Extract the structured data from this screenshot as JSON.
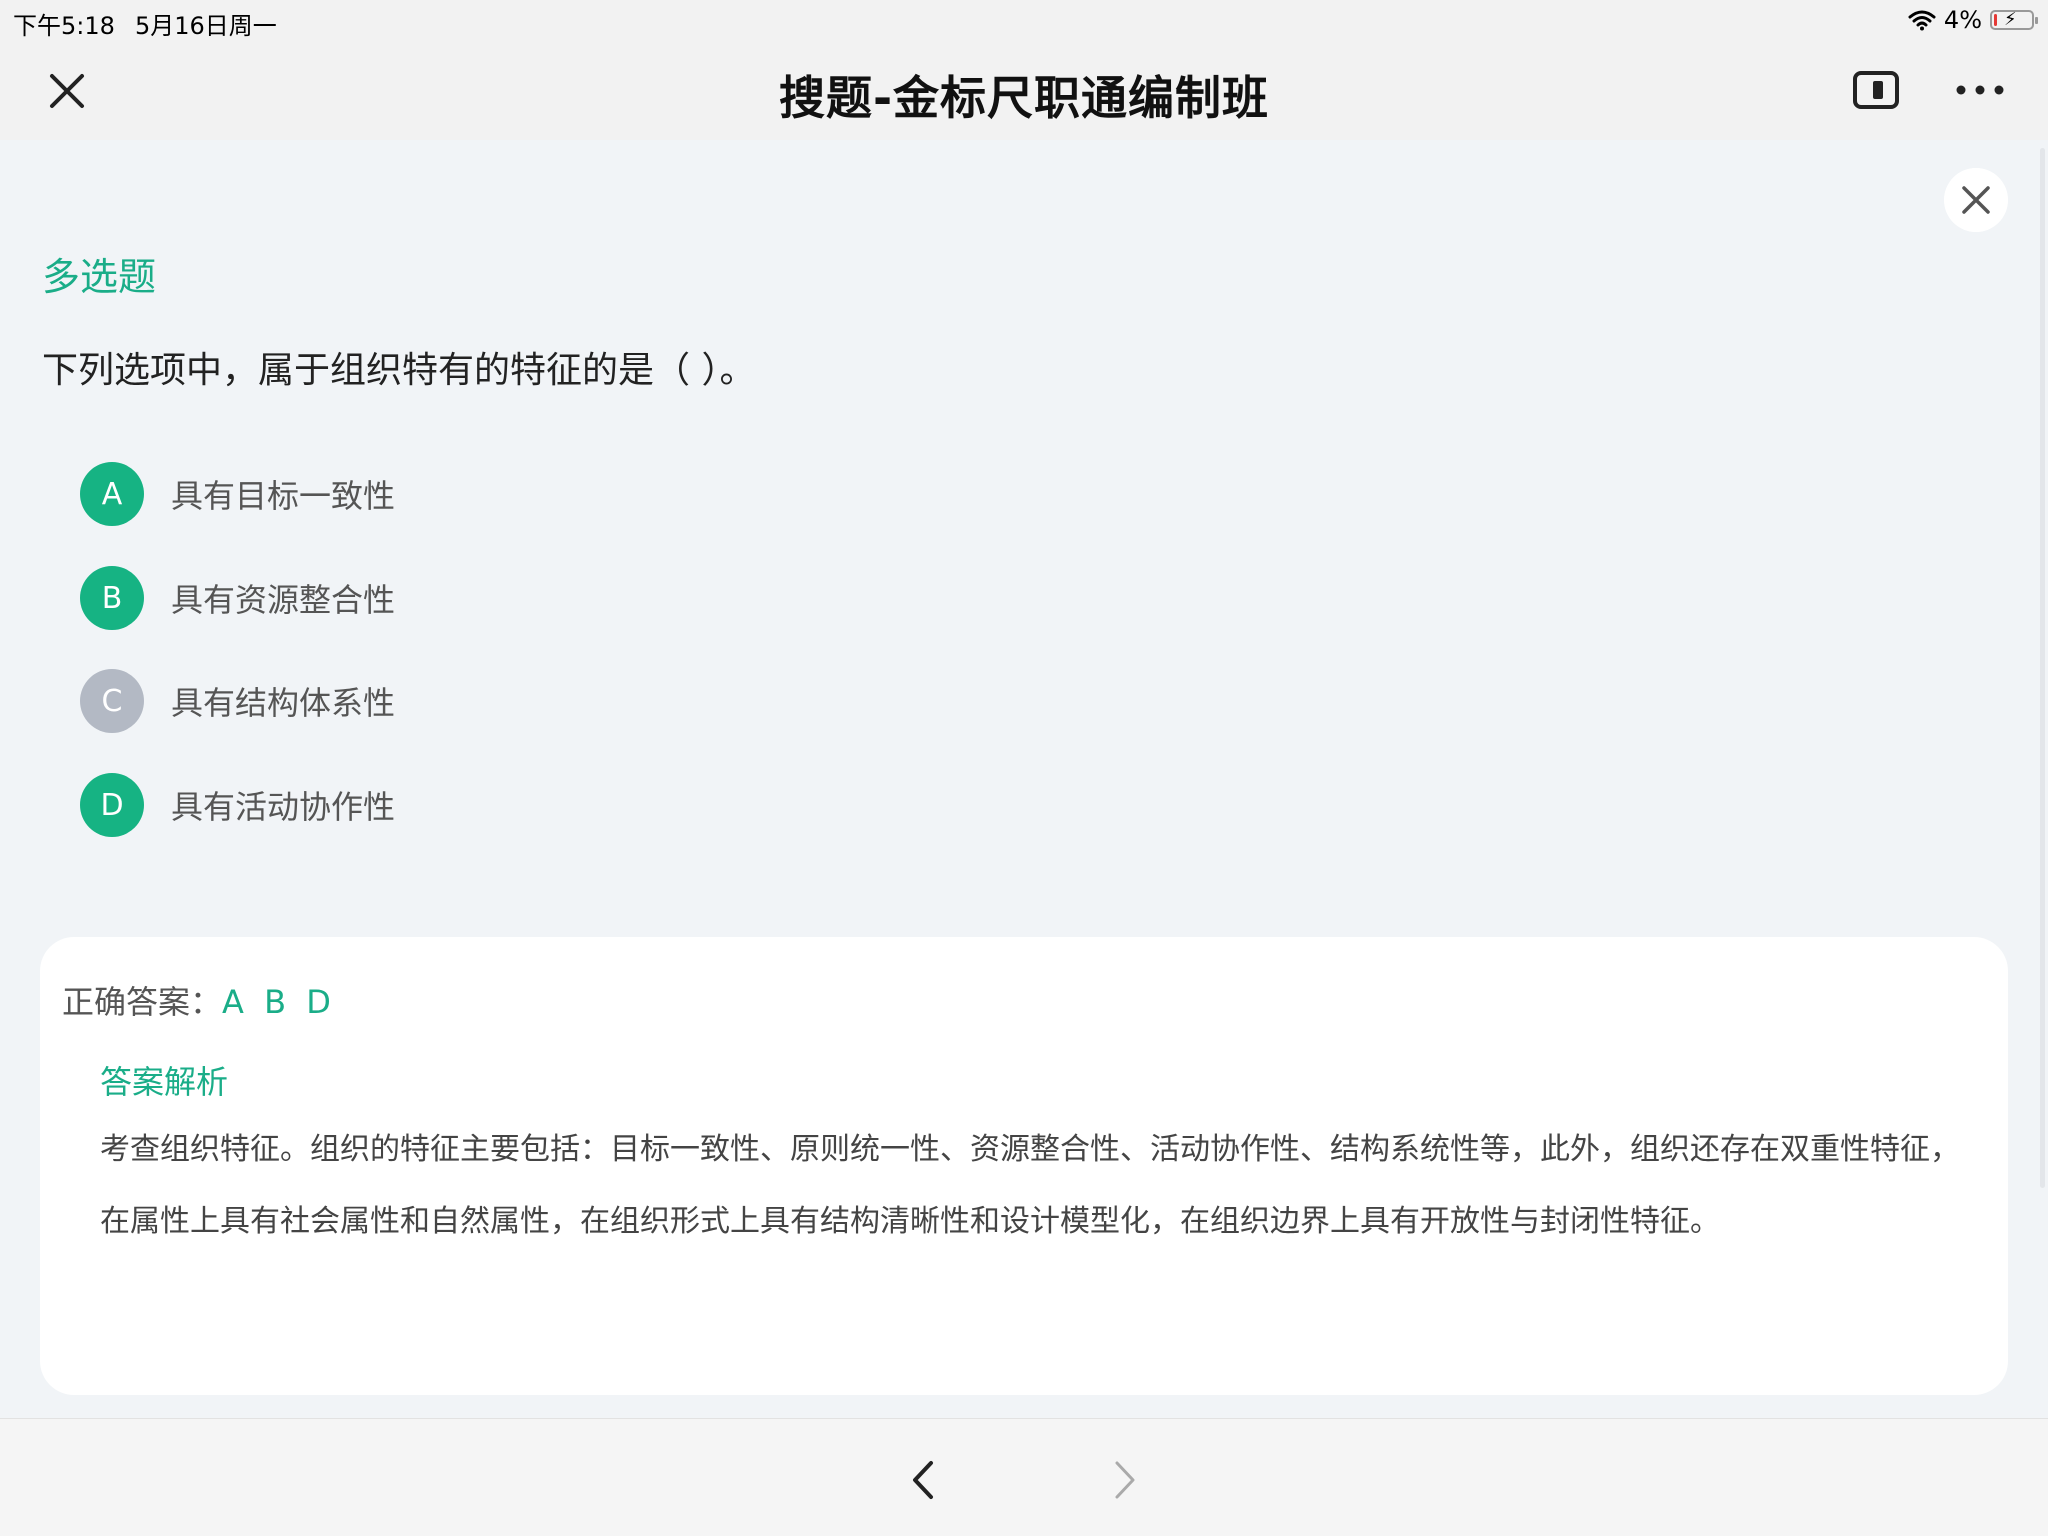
{
  "status_bar": {
    "time": "下午5:18",
    "date": "5月16日周一",
    "battery": "4%",
    "battery_level": 0.04,
    "wifi_icon": "wifi-icon"
  },
  "nav": {
    "title": "搜题-金标尺职通编制班",
    "close_icon": "close-icon",
    "window_icon": "window-icon",
    "more_icon": "more-icon"
  },
  "question": {
    "type": "多选题",
    "text": "下列选项中，属于组织特有的特征的是（ ）。",
    "options": [
      {
        "letter": "A",
        "text": "具有目标一致性",
        "correct": true
      },
      {
        "letter": "B",
        "text": "具有资源整合性",
        "correct": true
      },
      {
        "letter": "C",
        "text": "具有结构体系性",
        "correct": false
      },
      {
        "letter": "D",
        "text": "具有活动协作性",
        "correct": true
      }
    ]
  },
  "answer": {
    "label": "正确答案：",
    "value": "A B D",
    "analysis_title": "答案解析",
    "analysis_text": "考查组织特征。组织的特征主要包括：目标一致性、原则统一性、资源整合性、活动协作性、结构系统性等，此外，组织还存在双重性特征，在属性上具有社会属性和自然属性，在组织形式上具有结构清晰性和设计模型化，在组织边界上具有开放性与封闭性特征。"
  },
  "colors": {
    "accent": "#1aad88",
    "correct_option": "#16b383",
    "neutral_option": "#b3b9c4",
    "background": "#f1f4f7"
  }
}
